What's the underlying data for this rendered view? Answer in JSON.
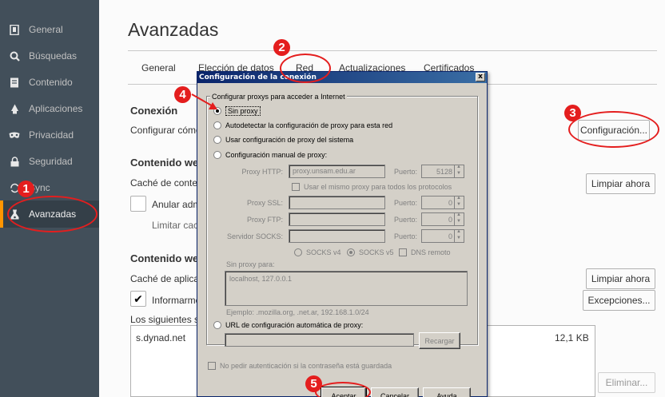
{
  "sidebar": {
    "items": [
      {
        "label": "General",
        "icon": "general-icon"
      },
      {
        "label": "Búsquedas",
        "icon": "search-icon"
      },
      {
        "label": "Contenido",
        "icon": "content-icon"
      },
      {
        "label": "Aplicaciones",
        "icon": "applications-icon"
      },
      {
        "label": "Privacidad",
        "icon": "privacy-mask-icon"
      },
      {
        "label": "Seguridad",
        "icon": "lock-icon"
      },
      {
        "label": "Sync",
        "icon": "sync-icon"
      },
      {
        "label": "Avanzadas",
        "icon": "advanced-icon"
      }
    ],
    "active": "Avanzadas"
  },
  "main": {
    "title": "Avanzadas",
    "tabs": [
      "General",
      "Elección de datos",
      "Red",
      "Actualizaciones",
      "Certificados"
    ],
    "active_tab": "Red",
    "connection": {
      "title": "Conexión",
      "text": "Configurar cómo",
      "button": "Configuración..."
    },
    "web_content": {
      "title": "Contenido web",
      "cache_text": "Caché de conten",
      "clear_button": "Limpiar ahora",
      "override_text": "Anular adm",
      "limit_text": "Limitar cach"
    },
    "offline_content": {
      "title": "Contenido web",
      "cache_text": "Caché de aplicac",
      "clear_button": "Limpiar ahora",
      "notify_text": "Informarme",
      "exceptions_button": "Excepciones...",
      "sites_text": "Los siguientes sit",
      "site_name": "s.dynad.net",
      "site_size": "12,1 KB",
      "remove_button": "Eliminar..."
    }
  },
  "dialog": {
    "title": "Configuración de la conexión",
    "close": "x",
    "group_legend": "Configurar proxys para acceder a Internet",
    "options": {
      "no_proxy": "Sin proxy",
      "auto_detect": "Autodetectar la configuración de proxy para esta red",
      "system": "Usar configuración de proxy del sistema",
      "manual": "Configuración manual de proxy:",
      "auto_url": "URL de configuración automática de proxy:"
    },
    "selected_option": "no_proxy",
    "manual": {
      "http_label": "Proxy HTTP:",
      "http_value": "proxy.unsam.edu.ar",
      "port_label": "Puerto:",
      "http_port": "5128",
      "same_proxy": "Usar el mismo proxy para todos los protocolos",
      "ssl_label": "Proxy SSL:",
      "ssl_port": "0",
      "ftp_label": "Proxy FTP:",
      "ftp_port": "0",
      "socks_label": "Servidor SOCKS:",
      "socks_port": "0",
      "socks_v4": "SOCKS v4",
      "socks_v5": "SOCKS v5",
      "dns_remote": "DNS remoto",
      "no_proxy_label": "Sin proxy para:",
      "no_proxy_value": "localhost, 127.0.0.1",
      "example": "Ejemplo: .mozilla.org, .net.ar, 192.168.1.0/24"
    },
    "reload_button": "Recargar",
    "no_auth_prompt": "No pedir autenticación si la contraseña está guardada",
    "buttons": {
      "ok": "Aceptar",
      "cancel": "Cancelar",
      "help": "Ayuda"
    }
  },
  "annotations": [
    "1",
    "2",
    "3",
    "4",
    "5"
  ],
  "colors": {
    "annotation": "#e41e1e",
    "sidebar": "#424f5a",
    "dialog_title": "#0a246a"
  }
}
